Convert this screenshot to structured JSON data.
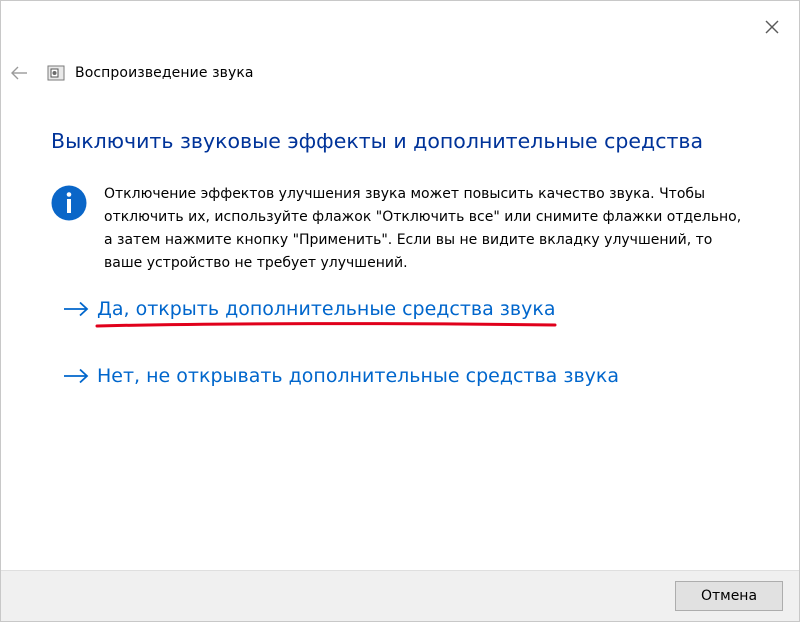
{
  "window": {
    "title": "Воспроизведение звука"
  },
  "content": {
    "heading": "Выключить звуковые эффекты и дополнительные средства",
    "info_text": "Отключение эффектов улучшения звука может повысить качество звука. Чтобы отключить их, используйте флажок \"Отключить все\" или снимите флажки отдельно, а затем нажмите кнопку \"Применить\". Если вы не видите вкладку улучшений, то ваше устройство не требует улучшений.",
    "links": [
      {
        "label": "Да, открыть дополнительные средства звука"
      },
      {
        "label": "Нет, не открывать дополнительные средства звука"
      }
    ]
  },
  "footer": {
    "cancel_label": "Отмена"
  },
  "icons": {
    "close": "close-icon",
    "back": "back-arrow-icon",
    "app": "speaker-app-icon",
    "info": "info-icon",
    "link_arrow": "arrow-right-icon"
  },
  "colors": {
    "heading": "#003399",
    "link": "#0066cc",
    "info_icon": "#0a66c8",
    "annotation": "#e0001b",
    "footer_bg": "#f0f0f0"
  }
}
